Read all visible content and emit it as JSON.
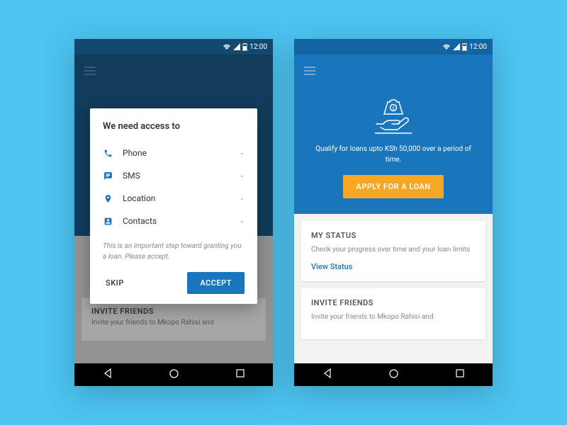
{
  "status": {
    "time": "12:00"
  },
  "dialog": {
    "title": "We need access to",
    "permissions": [
      {
        "label": "Phone",
        "icon": "phone"
      },
      {
        "label": "SMS",
        "icon": "sms"
      },
      {
        "label": "Location",
        "icon": "location"
      },
      {
        "label": "Contacts",
        "icon": "contacts"
      }
    ],
    "note": "This is an important step toward granting you a loan. Please accept.",
    "skip": "SKIP",
    "accept": "ACCEPT"
  },
  "bg_card": {
    "title": "INVITE FRIENDS",
    "desc": "Invite your friends to Mkopo Rahisi and"
  },
  "hero": {
    "text": "Qualify for loans upto KSh 50,000 over a period of time.",
    "cta": "APPLY FOR A LOAN"
  },
  "cards": {
    "status": {
      "title": "MY STATUS",
      "desc": "Check your progress over time and your loan limits",
      "link": "View Status"
    },
    "invite": {
      "title": "INVITE FRIENDS",
      "desc": "Invite your friends to Mkopo Rahisi and"
    }
  }
}
